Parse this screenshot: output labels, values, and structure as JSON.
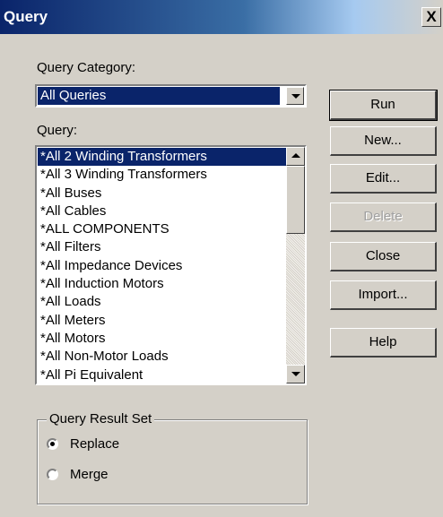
{
  "window": {
    "title": "Query",
    "close_glyph": "X"
  },
  "category": {
    "label": "Query Category:",
    "selected": "All Queries"
  },
  "query_list": {
    "label": "Query:",
    "items": [
      "*All 2 Winding Transformers",
      "*All 3 Winding Transformers",
      "*All Buses",
      "*All Cables",
      "*ALL COMPONENTS",
      "*All Filters",
      "*All Impedance Devices",
      "*All Induction Motors",
      "*All Loads",
      "*All Meters",
      "*All Motors",
      "*All Non-Motor Loads",
      "*All Pi Equivalent"
    ],
    "selected_index": 0
  },
  "buttons": {
    "run": "Run",
    "new": "New...",
    "edit": "Edit...",
    "delete": "Delete",
    "close": "Close",
    "import": "Import...",
    "help": "Help"
  },
  "result_set": {
    "title": "Query Result Set",
    "options": [
      "Replace",
      "Merge"
    ],
    "selected": "Replace"
  },
  "colors": {
    "face": "#d4d0c8",
    "selection": "#0a246a",
    "title_gradient_start": "#0a246a"
  },
  "icons": {
    "close": "close-icon",
    "combo_dropdown": "chevron-down-icon",
    "scroll_up": "arrow-up-icon",
    "scroll_down": "arrow-down-icon"
  }
}
